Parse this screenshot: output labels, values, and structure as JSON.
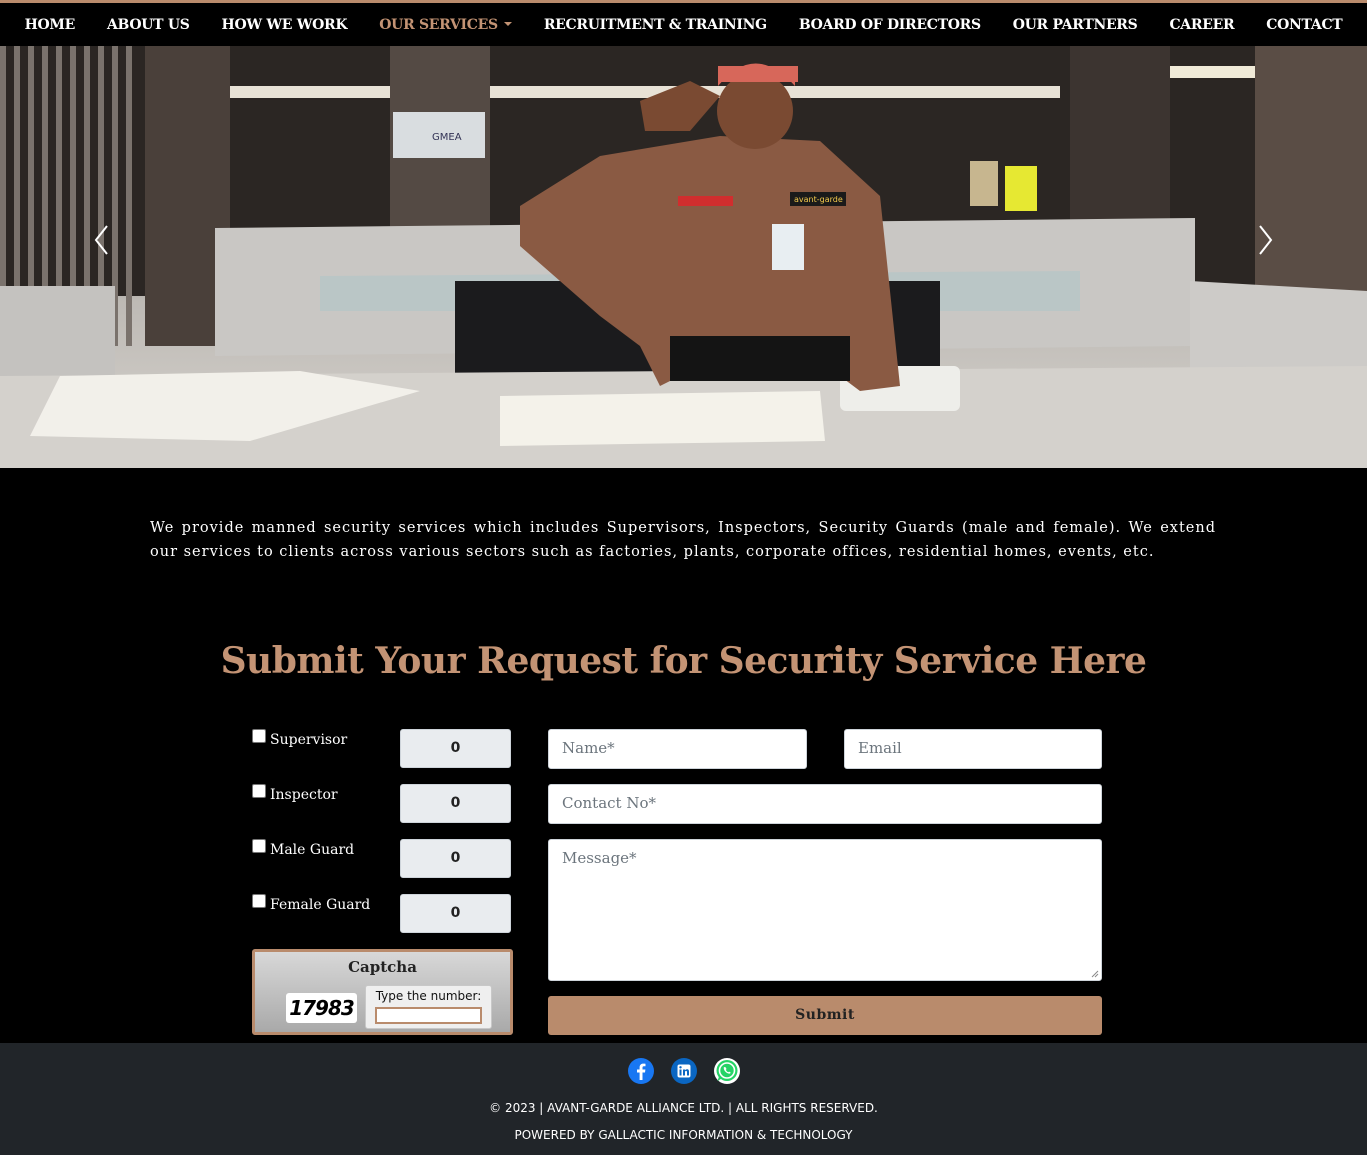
{
  "nav": {
    "items": [
      {
        "label": "HOME"
      },
      {
        "label": "ABOUT US"
      },
      {
        "label": "HOW WE WORK"
      },
      {
        "label": "OUR SERVICES"
      },
      {
        "label": "RECRUITMENT & TRAINING"
      },
      {
        "label": "BOARD OF DIRECTORS"
      },
      {
        "label": "OUR PARTNERS"
      },
      {
        "label": "CAREER"
      },
      {
        "label": "CONTACT"
      }
    ],
    "active_index": 3
  },
  "hero": {
    "badge_text": "avant-garde",
    "sign_text": "GMEA"
  },
  "intro": "We provide manned security services which includes Supervisors, Inspectors, Security Guards (male and female). We extend our services to clients across various sectors such as factories, plants, corporate offices, residential homes, events, etc.",
  "form": {
    "heading": "Submit Your Request for Security Service Here",
    "roles": [
      {
        "label": "Supervisor",
        "qty": "0"
      },
      {
        "label": "Inspector",
        "qty": "0"
      },
      {
        "label": "Male Guard",
        "qty": "0"
      },
      {
        "label": "Female Guard",
        "qty": "0"
      }
    ],
    "captcha": {
      "title": "Captcha",
      "number": "17983",
      "prompt": "Type the number:"
    },
    "name_placeholder": "Name*",
    "email_placeholder": "Email",
    "contact_placeholder": "Contact No*",
    "message_placeholder": "Message*",
    "submit_label": "Submit"
  },
  "footer": {
    "socials": [
      "facebook-icon",
      "linkedin-icon",
      "whatsapp-icon"
    ],
    "copyright": "© 2023 | AVANT-GARDE ALLIANCE LTD. | ALL RIGHTS RESERVED.",
    "powered": "POWERED BY GALLACTIC INFORMATION & TECHNOLOGY"
  },
  "colors": {
    "accent": "#b98b6c",
    "heading": "#c39374",
    "footer_bg": "#212529"
  }
}
